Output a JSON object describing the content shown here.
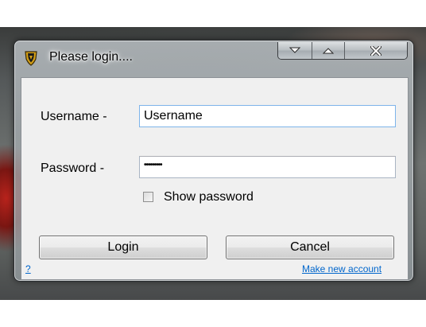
{
  "window": {
    "title": "Please login....",
    "icon": "shield-emblem-icon",
    "caption_buttons": [
      "minimize",
      "maximize",
      "close"
    ]
  },
  "form": {
    "username_label": "Username -",
    "username_value": "Username",
    "password_label": "Password -",
    "password_mask": "•••••••••",
    "show_password_label": "Show password",
    "show_password_checked": false
  },
  "buttons": {
    "login": "Login",
    "cancel": "Cancel"
  },
  "links": {
    "help": "?",
    "make_account": "Make new account"
  },
  "colors": {
    "link": "#0066cc",
    "focus_border": "#7eb4ea",
    "window_bg": "#f0f0f0"
  }
}
